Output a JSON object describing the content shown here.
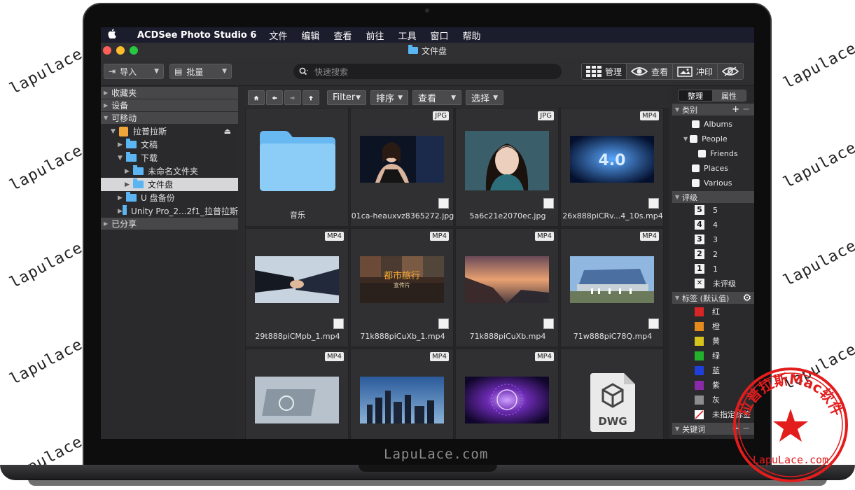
{
  "watermark": "lapulace.com",
  "brand_text": "LapuLace.com",
  "stamp": {
    "top_text": "拉普拉斯Mac软件",
    "bottom_text": "LapuLace.com",
    "color": "#e31c1c"
  },
  "menubar": {
    "app_name": "ACDSee Photo Studio 6",
    "items": [
      "文件",
      "编辑",
      "查看",
      "前往",
      "工具",
      "窗口",
      "帮助"
    ]
  },
  "window": {
    "title": "文件盘"
  },
  "toolbar": {
    "import_label": "导入",
    "batch_label": "批量",
    "search_placeholder": "快速搜索",
    "modes": [
      {
        "label": "管理",
        "icon": "grid-icon"
      },
      {
        "label": "查看",
        "icon": "eye-icon"
      },
      {
        "label": "冲印",
        "icon": "develop-icon"
      },
      {
        "label": "",
        "icon": "preview-icon"
      }
    ]
  },
  "left_panel": {
    "favorites": "收藏夹",
    "devices": "设备",
    "removable": "可移动",
    "drive": "拉普拉斯",
    "tree": [
      {
        "label": "文稿",
        "level": 1,
        "expanded": false
      },
      {
        "label": "下载",
        "level": 1,
        "expanded": true
      },
      {
        "label": "未命名文件夹",
        "level": 2,
        "expanded": false
      },
      {
        "label": "文件盘",
        "level": 2,
        "expanded": false,
        "selected": true
      },
      {
        "label": "U 盘备份",
        "level": 1,
        "expanded": false
      },
      {
        "label": "Unity Pro_2...2f1_拉普拉斯",
        "level": 1,
        "expanded": false
      }
    ],
    "shared": "已分享"
  },
  "nav": {
    "filter": "Filter",
    "sort": "排序",
    "view": "查看",
    "select": "选择"
  },
  "files": [
    {
      "name": "音乐",
      "type": "",
      "kind": "folder"
    },
    {
      "name": "01ca-heauxvz8365272.jpg",
      "type": "JPG",
      "kind": "portrait-dark"
    },
    {
      "name": "5a6c21e2070ec.jpg",
      "type": "JPG",
      "kind": "portrait-teal"
    },
    {
      "name": "26x888piCRv...4_10s.mp4",
      "type": "MP4",
      "kind": "blue-tech"
    },
    {
      "name": "29t888piCMpb_1.mp4",
      "type": "MP4",
      "kind": "handshake"
    },
    {
      "name": "71k888piCuXb_1.mp4",
      "type": "MP4",
      "kind": "city-promo"
    },
    {
      "name": "71k888piCuXb.mp4",
      "type": "MP4",
      "kind": "sunset"
    },
    {
      "name": "71w888piC78Q.mp4",
      "type": "MP4",
      "kind": "building"
    },
    {
      "name": "",
      "type": "MP4",
      "kind": "hud"
    },
    {
      "name": "",
      "type": "MP4",
      "kind": "skyline"
    },
    {
      "name": "",
      "type": "MP4",
      "kind": "purple-burst"
    },
    {
      "name": "",
      "type": "",
      "kind": "dwg",
      "doc_label": "DWG"
    }
  ],
  "thumb_text": {
    "city_title": "都市旅行",
    "city_sub": "宣传片",
    "tech_number": "4.0"
  },
  "right_panel": {
    "tabs": [
      "整理",
      "属性"
    ],
    "categories_header": "类别",
    "categories": [
      "Albums",
      "People",
      "Friends",
      "Places",
      "Various"
    ],
    "rating_header": "评级",
    "ratings": [
      {
        "num": "5",
        "label": "5"
      },
      {
        "num": "4",
        "label": "4"
      },
      {
        "num": "3",
        "label": "3"
      },
      {
        "num": "2",
        "label": "2"
      },
      {
        "num": "1",
        "label": "1"
      },
      {
        "num": "✕",
        "label": "未评级"
      }
    ],
    "labels_header": "标签 (默认值)",
    "labels": [
      {
        "name": "红",
        "color": "#d92525"
      },
      {
        "name": "橙",
        "color": "#e58a1d"
      },
      {
        "name": "黄",
        "color": "#d6c31c"
      },
      {
        "name": "绿",
        "color": "#22b22b"
      },
      {
        "name": "蓝",
        "color": "#1f3fd8"
      },
      {
        "name": "紫",
        "color": "#8a2aa8"
      },
      {
        "name": "灰",
        "color": "#8c8c8c"
      },
      {
        "name": "未指定标签",
        "color": "none"
      }
    ],
    "keywords_header": "关键词"
  }
}
